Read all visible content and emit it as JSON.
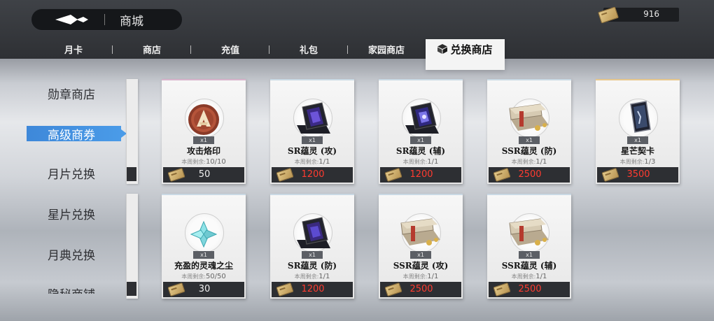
{
  "header": {
    "title": "商城",
    "currency_value": "916"
  },
  "tabs": [
    {
      "label": "月卡",
      "active": false
    },
    {
      "label": "商店",
      "active": false
    },
    {
      "label": "充值",
      "active": false
    },
    {
      "label": "礼包",
      "active": false
    },
    {
      "label": "家园商店",
      "active": false
    },
    {
      "label": "兑换商店",
      "active": true,
      "icon": "cube-icon"
    }
  ],
  "sidebar": {
    "items": [
      {
        "label": "勋章商店",
        "active": false
      },
      {
        "label": "高级商券",
        "active": true
      },
      {
        "label": "月片兑换",
        "active": false
      },
      {
        "label": "星片兑换",
        "active": false
      },
      {
        "label": "月典兑换",
        "active": false
      },
      {
        "label": "隐秘商铺",
        "active": false
      }
    ]
  },
  "items": [
    {
      "name": "攻击烙印",
      "qty": "x1",
      "limit_label": "本周剩余:",
      "limit_value": "10/10",
      "price": "50",
      "affordable": true,
      "icon": "attack-seal-icon"
    },
    {
      "name": "SR蕴灵 (攻)",
      "qty": "x1",
      "limit_label": "本周剩余:",
      "limit_value": "1/1",
      "price": "1200",
      "affordable": false,
      "icon": "card-case-icon"
    },
    {
      "name": "SR蕴灵 (辅)",
      "qty": "x1",
      "limit_label": "本周剩余:",
      "limit_value": "1/1",
      "price": "1200",
      "affordable": false,
      "icon": "card-case-icon"
    },
    {
      "name": "SSR蕴灵 (防)",
      "qty": "x1",
      "limit_label": "本周剩余:",
      "limit_value": "1/1",
      "price": "2500",
      "affordable": false,
      "icon": "treasure-crate-icon"
    },
    {
      "name": "星芒契卡",
      "qty": "x1",
      "limit_label": "本周剩余:",
      "limit_value": "1/3",
      "price": "3500",
      "affordable": false,
      "icon": "star-card-icon"
    },
    {
      "name": "充盈的灵魂之尘",
      "qty": "x1",
      "limit_label": "本周剩余:",
      "limit_value": "50/50",
      "price": "30",
      "affordable": true,
      "icon": "soul-dust-icon"
    },
    {
      "name": "SR蕴灵 (防)",
      "qty": "x1",
      "limit_label": "本周剩余:",
      "limit_value": "1/1",
      "price": "1200",
      "affordable": false,
      "icon": "card-case-icon"
    },
    {
      "name": "SSR蕴灵 (攻)",
      "qty": "x1",
      "limit_label": "本周剩余:",
      "limit_value": "1/1",
      "price": "2500",
      "affordable": false,
      "icon": "treasure-crate-icon"
    },
    {
      "name": "SSR蕴灵 (辅)",
      "qty": "x1",
      "limit_label": "本周剩余:",
      "limit_value": "1/1",
      "price": "2500",
      "affordable": false,
      "icon": "treasure-crate-icon"
    }
  ],
  "colors": {
    "price_unaffordable": "#ff3b30",
    "price_affordable": "#f0f0f0",
    "sidebar_active": "#4a9be8"
  }
}
